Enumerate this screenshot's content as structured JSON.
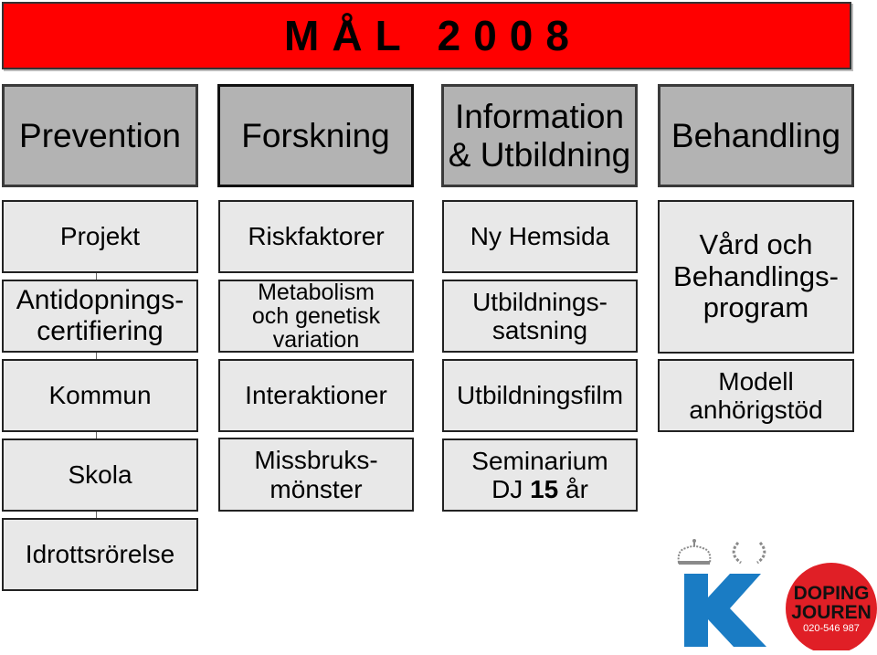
{
  "banner": {
    "title": "MÅL 2008",
    "color": "#ff0000"
  },
  "columns": [
    {
      "header": "Prevention",
      "items": [
        "Projekt",
        "Antidopnings-\ncertifiering",
        "Kommun",
        "Skola",
        "Idrottsrörelse"
      ]
    },
    {
      "header": "Forskning",
      "items": [
        "Riskfaktorer",
        "Metabolism\noch genetisk\nvariation",
        "Interaktioner",
        "Missbruks-\nmönster"
      ]
    },
    {
      "header": "Information\n& Utbildning",
      "items": [
        "Ny Hemsida",
        "Utbildnings-\nsatsning",
        "Utbildningsfilm"
      ],
      "seminar": {
        "prefix": "Seminarium\nDJ ",
        "bold": "15",
        "suffix": " år"
      }
    },
    {
      "header": "Behandling",
      "items": [
        "Vård och\nBehandlings-\nprogram",
        "Modell\nanhörigstöd"
      ]
    }
  ],
  "logos": {
    "k_logo": {
      "letter": "K",
      "color": "#1a7cc4",
      "icons": [
        "crown-icon",
        "laurel-wreath-icon"
      ]
    },
    "dopingjouren": {
      "line1": "DOPING",
      "line2": "JOUREN",
      "phone": "020-546 987",
      "color": "#e01f26"
    }
  }
}
